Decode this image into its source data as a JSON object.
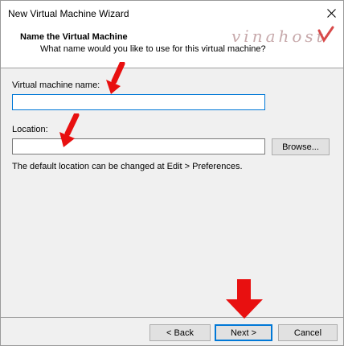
{
  "window": {
    "title": "New Virtual Machine Wizard"
  },
  "header": {
    "title": "Name the Virtual Machine",
    "subtitle": "What name would you like to use for this virtual machine?",
    "watermark": "vinahost"
  },
  "form": {
    "name_label": "Virtual machine name:",
    "name_value": "",
    "location_label": "Location:",
    "location_value": "",
    "browse_label": "Browse...",
    "hint": "The default location can be changed at Edit > Preferences."
  },
  "footer": {
    "back_label": "< Back",
    "next_label": "Next >",
    "cancel_label": "Cancel"
  },
  "icons": {
    "close": "close-icon",
    "arrow": "red-arrow-icon"
  },
  "colors": {
    "arrow": "#e81010",
    "focus": "#0078d7",
    "watermark": "#c7a9ab"
  }
}
